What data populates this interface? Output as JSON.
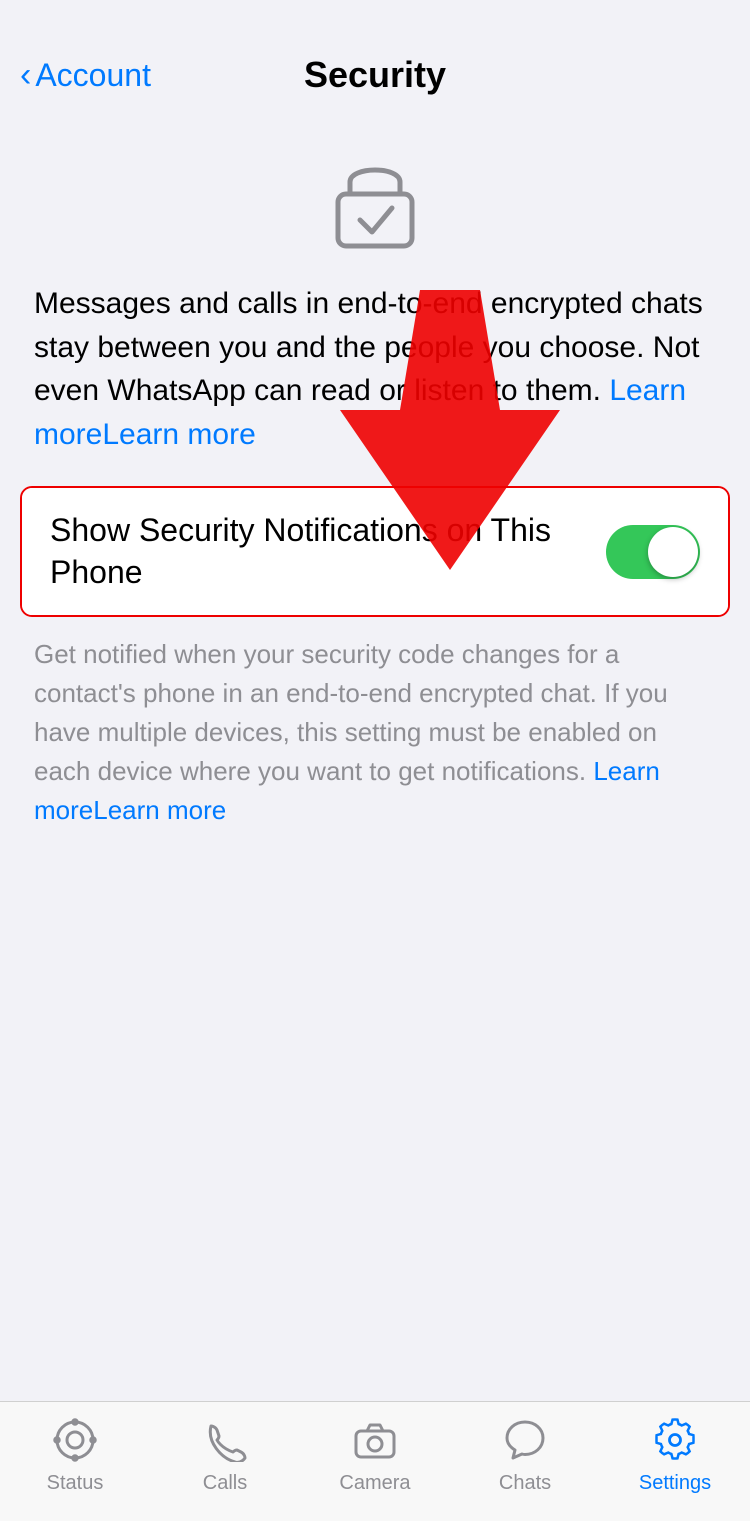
{
  "header": {
    "back_label": "Account",
    "title": "Security",
    "back_chevron": "‹"
  },
  "description": {
    "main_text": "Messages and calls in end-to-end encrypted chats stay between you and the people you choose. Not even WhatsApp can read or listen to them.",
    "learn_more_1": "Learn more"
  },
  "toggle_row": {
    "label": "Show Security Notifications on This Phone",
    "enabled": true
  },
  "sub_description": {
    "text": "Get notified when your security code changes for a contact's phone in an end-to-end encrypted chat. If you have multiple devices, this setting must be enabled on each device where you want to get notifications.",
    "learn_more": "Learn more"
  },
  "tab_bar": {
    "items": [
      {
        "label": "Status",
        "icon": "status-icon",
        "active": false
      },
      {
        "label": "Calls",
        "icon": "calls-icon",
        "active": false
      },
      {
        "label": "Camera",
        "icon": "camera-icon",
        "active": false
      },
      {
        "label": "Chats",
        "icon": "chats-icon",
        "active": false
      },
      {
        "label": "Settings",
        "icon": "settings-icon",
        "active": true
      }
    ]
  }
}
